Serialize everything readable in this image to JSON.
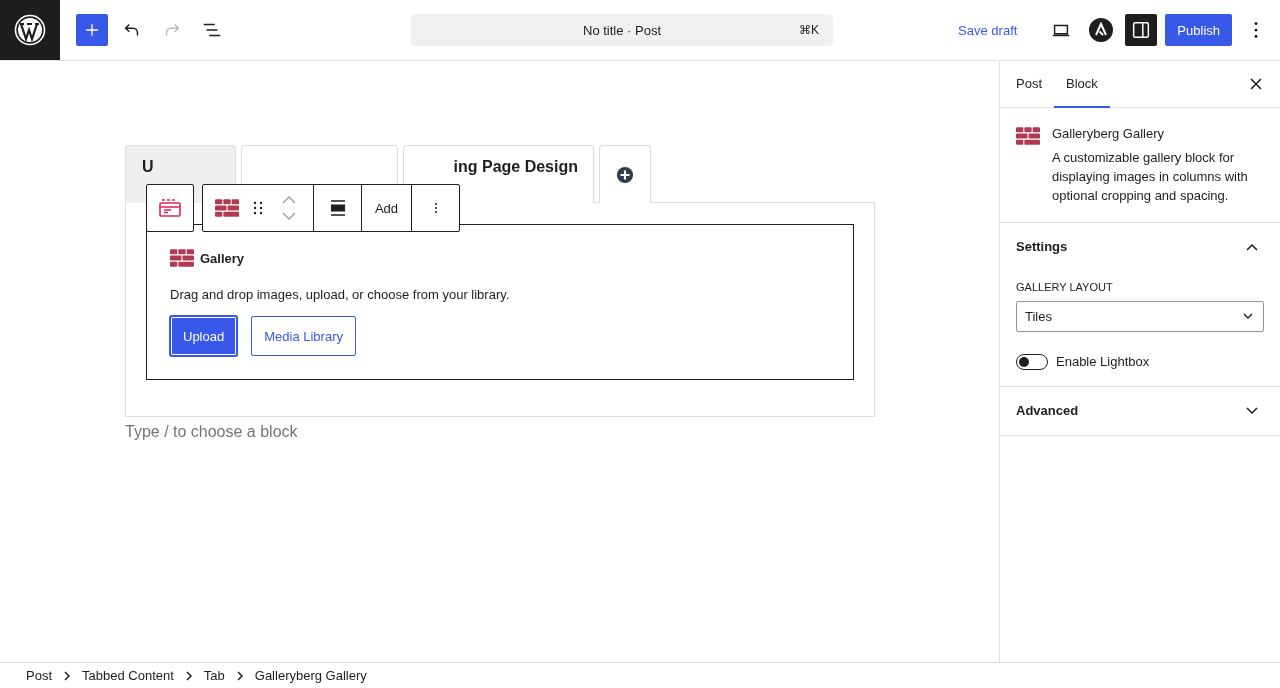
{
  "top_bar": {
    "document_title": "No title · Post",
    "shortcut": "⌘K",
    "save_draft": "Save draft",
    "publish": "Publish",
    "redo_disabled": true,
    "settings_open": true
  },
  "content_tabs": [
    {
      "label": "U",
      "selected": true
    },
    {
      "selected": false
    },
    {
      "label": "ing Page Design",
      "selected": false
    }
  ],
  "block_toolbar": {
    "add": "Add"
  },
  "gallery_block": {
    "title": "Gallery",
    "instructions": "Drag and drop images, upload, or choose from your library.",
    "buttons": [
      {
        "label": "Upload",
        "kind": "primary"
      },
      {
        "label": "Media Library",
        "kind": "secondary"
      }
    ]
  },
  "appender": {
    "placeholder": "Type / to choose a block"
  },
  "sidebar": {
    "tabs": [
      {
        "label": "Post",
        "selected": false
      },
      {
        "label": "Block",
        "selected": true
      }
    ],
    "block_card": {
      "title": "Galleryberg Gallery",
      "description": "A customizable gallery block for displaying images in columns with optional cropping and spacing."
    },
    "panels": [
      {
        "title": "Settings",
        "expanded": true,
        "layout_label": "GALLERY LAYOUT",
        "layout_value": "Tiles",
        "lightbox": {
          "label": "Enable Lightbox",
          "on": false
        }
      },
      {
        "title": "Advanced",
        "expanded": false
      }
    ]
  },
  "breadcrumbs": [
    "Post",
    "Tabbed Content",
    "Tab",
    "Galleryberg Gallery"
  ]
}
